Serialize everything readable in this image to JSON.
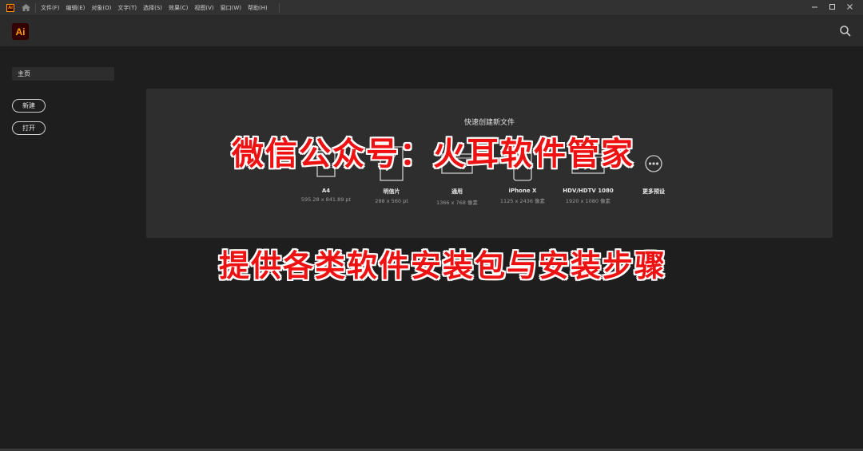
{
  "menubar": {
    "logo_text": "Ai",
    "items": [
      "文件(F)",
      "编辑(E)",
      "对象(O)",
      "文字(T)",
      "选择(S)",
      "效果(C)",
      "视图(V)",
      "窗口(W)",
      "帮助(H)"
    ],
    "window_controls": [
      "minimize-icon",
      "maximize-icon",
      "close-icon"
    ]
  },
  "appbar": {
    "logo_text": "Ai",
    "accent_color": "#ff9a00",
    "logo_bg": "#330000"
  },
  "sidebar": {
    "home_label": "主页",
    "new_label": "新建",
    "open_label": "打开"
  },
  "quick_create": {
    "title": "快速创建新文件",
    "presets": [
      {
        "name": "A4",
        "size": "595.28 x 841.89 pt",
        "icon": "document-icon"
      },
      {
        "name": "明信片",
        "size": "288 x 560 pt",
        "icon": "brush-icon"
      },
      {
        "name": "通用",
        "size": "1366 x 768 像素",
        "icon": "laptop-icon"
      },
      {
        "name": "iPhone X",
        "size": "1125 x 2436 像素",
        "icon": "phone-icon"
      },
      {
        "name": "HDV/HDTV 1080",
        "size": "1920 x 1080 像素",
        "icon": "video-icon"
      },
      {
        "name": "更多预设",
        "size": "",
        "icon": "more-icon"
      }
    ]
  },
  "watermark": {
    "line1": "微信公众号：火耳软件管家",
    "line2": "提供各类软件安装包与安装步骤",
    "color": "#ee1111"
  }
}
